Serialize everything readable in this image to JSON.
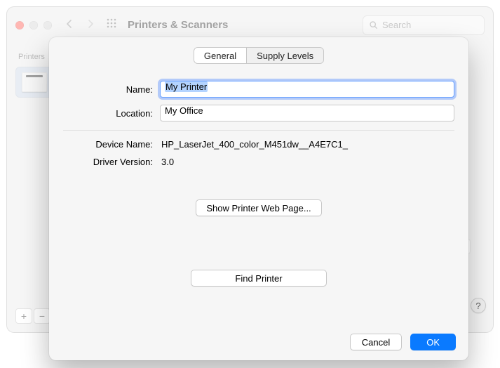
{
  "window": {
    "title": "Printers & Scanners",
    "search_placeholder": "Search"
  },
  "sidebar": {
    "header": "Printers",
    "add_symbol": "+",
    "remove_symbol": "−"
  },
  "behind": {
    "more_symbol": "..."
  },
  "sheet": {
    "tabs": {
      "general": "General",
      "supply": "Supply Levels"
    },
    "labels": {
      "name": "Name:",
      "location": "Location:",
      "device_name": "Device Name:",
      "driver_version": "Driver Version:"
    },
    "values": {
      "name": "My Printer",
      "location": "My Office",
      "device_name": "HP_LaserJet_400_color_M451dw__A4E7C1_",
      "driver_version": "3.0"
    },
    "buttons": {
      "web_page": "Show Printer Web Page...",
      "find": "Find Printer",
      "cancel": "Cancel",
      "ok": "OK"
    }
  },
  "help_symbol": "?"
}
